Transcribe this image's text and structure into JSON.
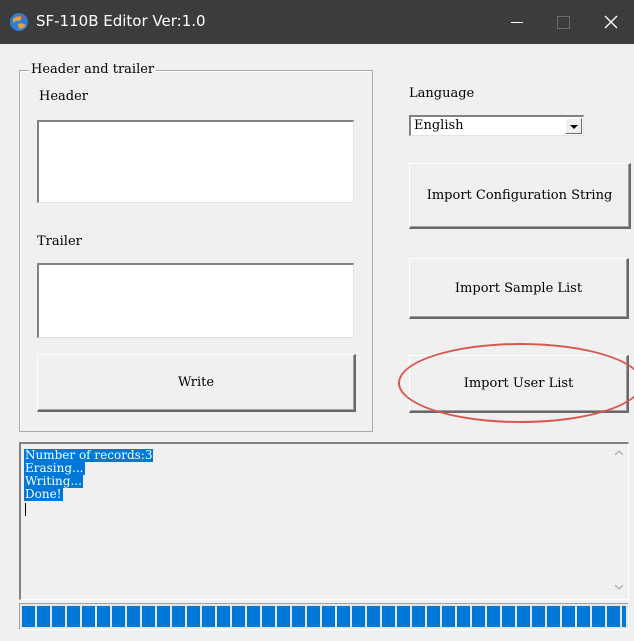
{
  "window": {
    "title": "SF-110B Editor Ver:1.0",
    "icons": {
      "app": "app-logo-icon",
      "minimize": "minimize-icon",
      "maximize": "maximize-icon",
      "close": "close-icon"
    }
  },
  "group": {
    "title": "Header and trailer",
    "header_label": "Header",
    "header_value": "",
    "trailer_label": "Trailer",
    "trailer_value": "",
    "write_button": "Write"
  },
  "language": {
    "label": "Language",
    "selected": "English"
  },
  "buttons": {
    "import_config": "Import Configuration String",
    "import_sample": "Import Sample List",
    "import_user": "Import User List"
  },
  "log": {
    "lines": [
      "Number of records:3",
      "Erasing...",
      "Writing...",
      "Done!"
    ]
  },
  "progress": {
    "percent": 100
  },
  "colors": {
    "titlebar": "#3c3c3c",
    "selection": "#0078d7",
    "progress": "#0078d7",
    "annotation": "#d9574f"
  }
}
